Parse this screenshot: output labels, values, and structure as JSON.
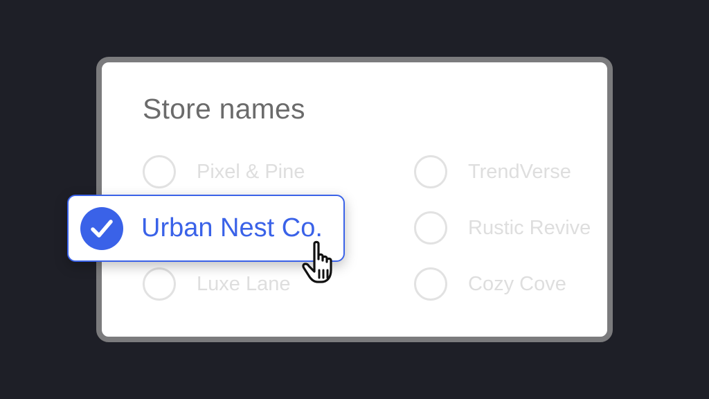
{
  "card": {
    "title": "Store names"
  },
  "options": [
    {
      "label": "Pixel & Pine",
      "checked": false
    },
    {
      "label": "TrendVerse",
      "checked": false
    },
    {
      "label": "Urban Nest Co.",
      "checked": true
    },
    {
      "label": "Rustic Revive",
      "checked": false
    },
    {
      "label": "Luxe Lane",
      "checked": false
    },
    {
      "label": "Cozy Cove",
      "checked": false
    }
  ],
  "selected": {
    "label": "Urban Nest Co.",
    "icon": "check-icon"
  },
  "pointer": {
    "icon": "hand-pointer-icon"
  },
  "colors": {
    "background": "#1e1f27",
    "card_border": "#7b7b7d",
    "accent": "#3a62e8",
    "unselected_text": "#dedede",
    "title_text": "#6b6b6b"
  }
}
